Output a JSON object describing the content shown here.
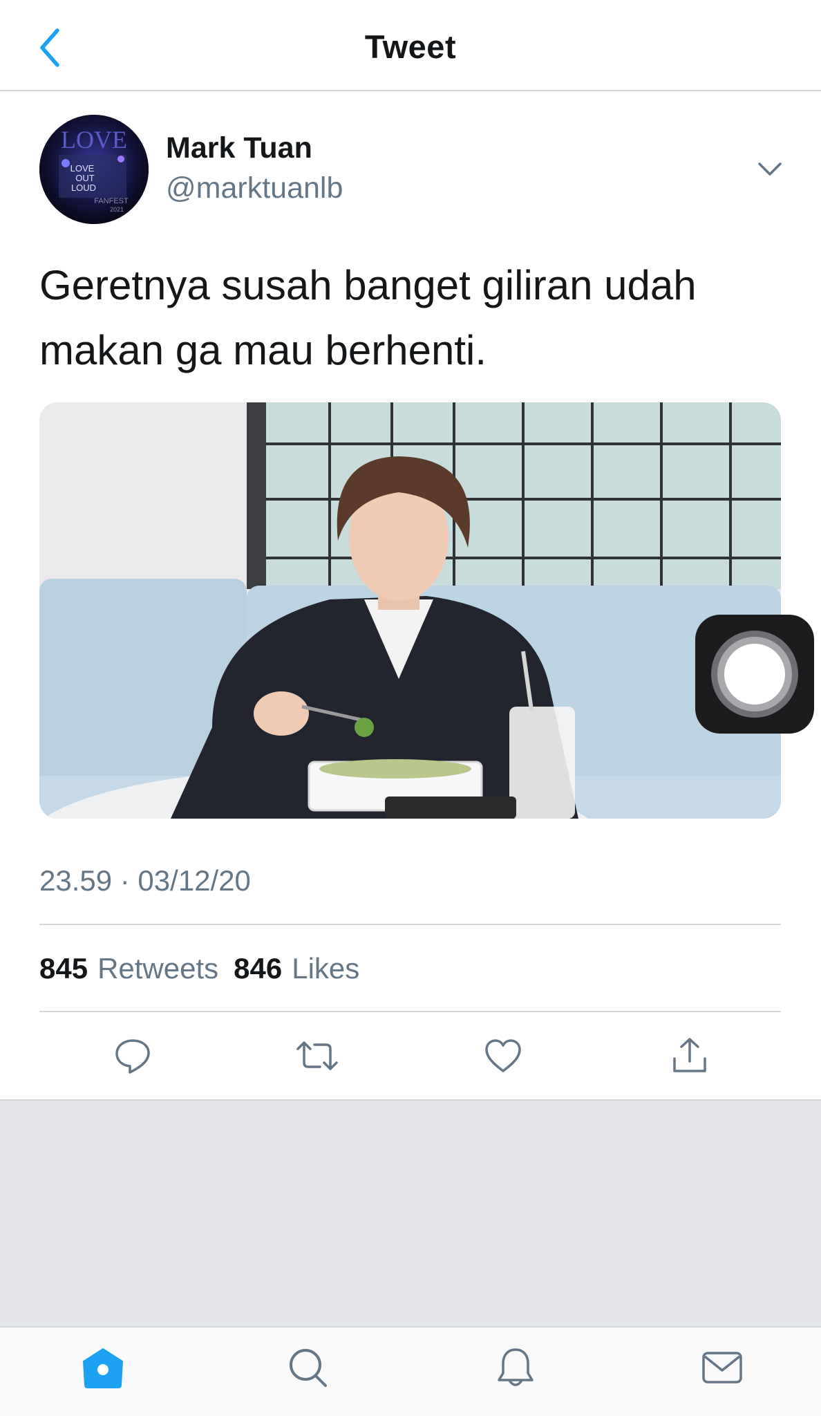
{
  "header": {
    "title": "Tweet",
    "back_icon": "chevron-left-icon"
  },
  "author": {
    "name": "Mark Tuan",
    "handle": "@marktuanlb",
    "avatar_text": [
      "LOVE",
      "LOVE",
      "OUT",
      "LOUD",
      "FANFEST",
      "2021"
    ]
  },
  "tweet": {
    "text_line1": "Geretnya susah banget giliran udah",
    "text_line2": "makan ga mau berhenti."
  },
  "timestamp": "23.59 · 03/12/20",
  "stats": {
    "retweets_count": "845",
    "retweets_label": "Retweets",
    "likes_count": "846",
    "likes_label": "Likes"
  },
  "actions": [
    "reply-icon",
    "retweet-icon",
    "like-icon",
    "share-icon"
  ],
  "tabbar": [
    "home-icon",
    "search-icon",
    "notifications-icon",
    "messages-icon"
  ],
  "colors": {
    "accent": "#1da1f2",
    "icon_grey": "#657786",
    "divider": "#d6d9dc"
  }
}
